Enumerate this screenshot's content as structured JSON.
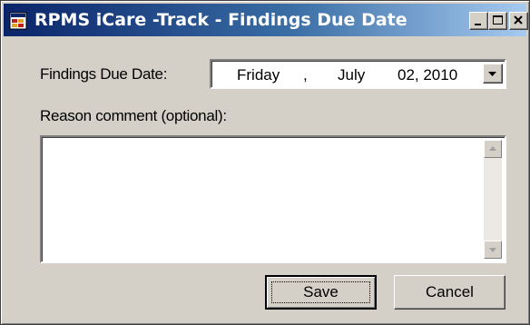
{
  "window": {
    "title": "RPMS iCare -Track - Findings Due Date",
    "icons": {
      "app": "app-icon",
      "minimize": "minimize-icon",
      "maximize": "maximize-icon",
      "close": "close-icon"
    }
  },
  "form": {
    "date_label": "Findings Due Date:",
    "date_value": {
      "day": "Friday",
      "separator": ",",
      "month": "July",
      "date": "02, 2010"
    },
    "reason_label": "Reason comment (optional):",
    "reason_value": ""
  },
  "buttons": {
    "save": "Save",
    "cancel": "Cancel"
  },
  "colors": {
    "face": "#d4d0c8",
    "titlebar_start": "#0a246a",
    "titlebar_end": "#a6caf0"
  }
}
